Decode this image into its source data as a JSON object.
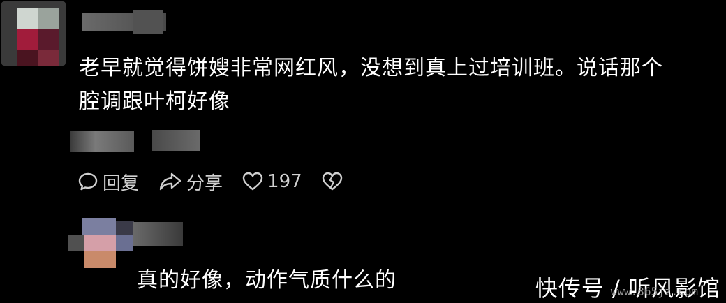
{
  "comment1": {
    "text_line1": "老早就觉得饼嫂非常网红风，没想到真上过培训班。说话那个",
    "text_line2": "腔调跟叶柯好像",
    "actions": {
      "reply_label": "回复",
      "share_label": "分享",
      "like_count": "197"
    }
  },
  "comment2": {
    "text": "真的好像，动作气质什么的"
  },
  "watermark": {
    "label": "快传号 / 听风影馆",
    "url": "www.365jz.com"
  }
}
